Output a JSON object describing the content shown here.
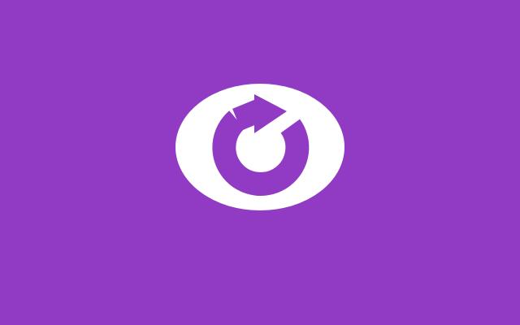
{
  "colors": {
    "background": "#913BC5",
    "ellipse": "#FFFFFF",
    "glyph": "#913BC5"
  },
  "logo": {
    "icon": "refresh-arrow-eye-icon"
  }
}
